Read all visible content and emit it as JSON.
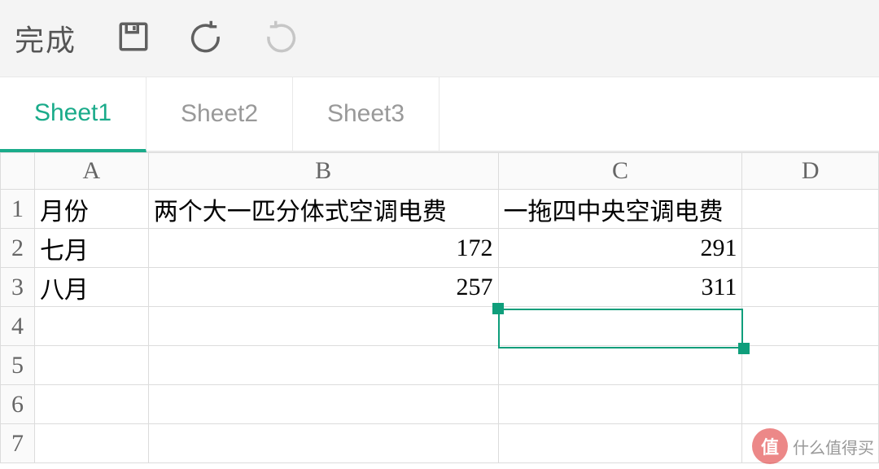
{
  "toolbar": {
    "done_label": "完成"
  },
  "tabs": [
    "Sheet1",
    "Sheet2",
    "Sheet3"
  ],
  "columns": [
    "A",
    "B",
    "C",
    "D"
  ],
  "row_numbers": [
    "1",
    "2",
    "3",
    "4",
    "5",
    "6",
    "7"
  ],
  "cells": {
    "A1": "月份",
    "B1": "两个大一匹分体式空调电费",
    "C1": "一拖四中央空调电费",
    "A2": "七月",
    "B2": "172",
    "C2": "291",
    "A3": "八月",
    "B3": "257",
    "C3": "311"
  },
  "chart_data": {
    "type": "table",
    "title": "",
    "columns": [
      "月份",
      "两个大一匹分体式空调电费",
      "一拖四中央空调电费"
    ],
    "rows": [
      {
        "月份": "七月",
        "两个大一匹分体式空调电费": 172,
        "一拖四中央空调电费": 291
      },
      {
        "月份": "八月",
        "两个大一匹分体式空调电费": 257,
        "一拖四中央空调电费": 311
      }
    ]
  },
  "watermark": {
    "badge": "值",
    "text": "什么值得买"
  }
}
